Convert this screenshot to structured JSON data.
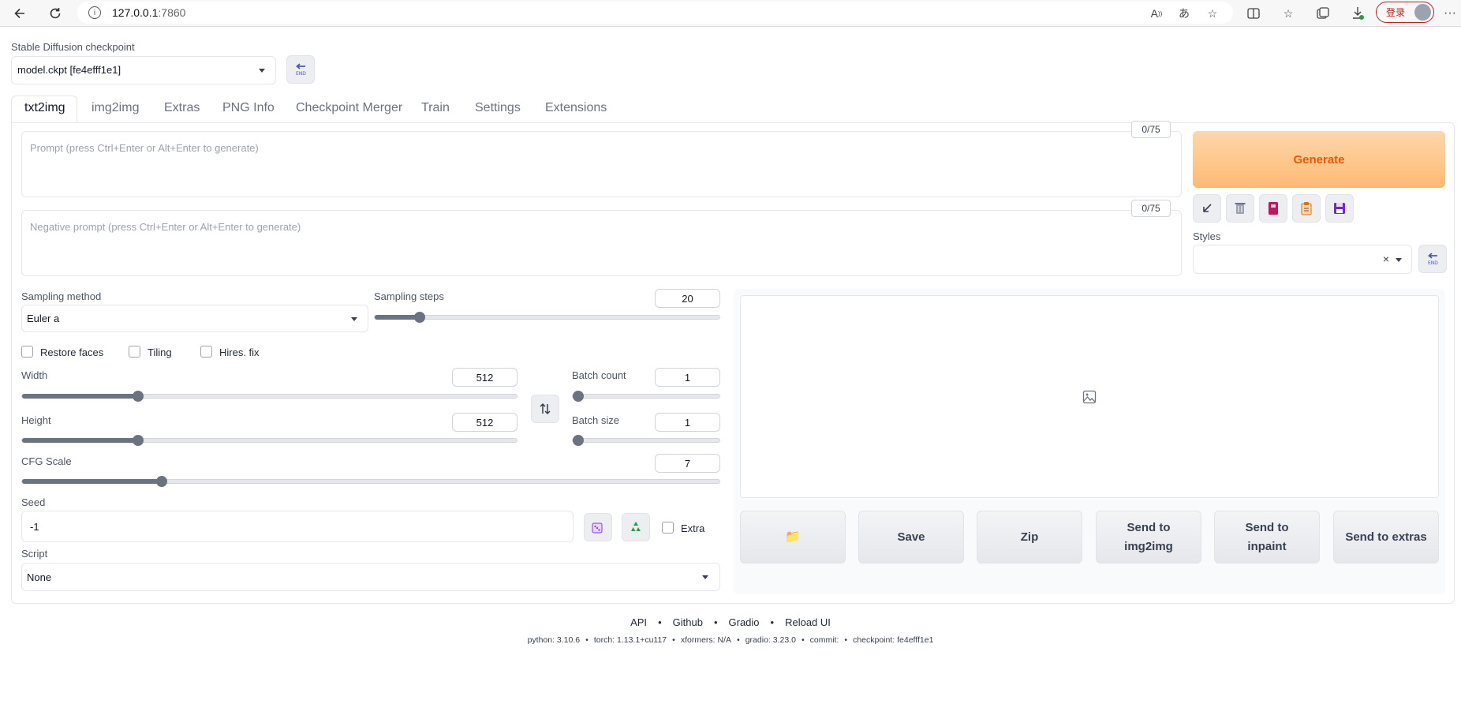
{
  "browser": {
    "url_host": "127.0.0.1",
    "url_port": ":7860",
    "login_label": "登录",
    "icons": [
      "back-icon",
      "refresh-icon",
      "info-icon",
      "read-aloud-icon",
      "translate-icon",
      "favorite-add-icon",
      "split-screen-icon",
      "favorites-icon",
      "collections-icon",
      "downloads-icon",
      "profile-icon",
      "more-icon"
    ]
  },
  "checkpoint": {
    "label": "Stable Diffusion checkpoint",
    "value": "model.ckpt [fe4efff1e1]"
  },
  "tabs": [
    {
      "label": "txt2img",
      "active": true
    },
    {
      "label": "img2img"
    },
    {
      "label": "Extras"
    },
    {
      "label": "PNG Info"
    },
    {
      "label": "Checkpoint Merger"
    },
    {
      "label": "Train"
    },
    {
      "label": "Settings"
    },
    {
      "label": "Extensions"
    }
  ],
  "prompt": {
    "placeholder": "Prompt (press Ctrl+Enter or Alt+Enter to generate)",
    "token_count": "0/75"
  },
  "negative_prompt": {
    "placeholder": "Negative prompt (press Ctrl+Enter or Alt+Enter to generate)",
    "token_count": "0/75"
  },
  "generate": {
    "label": "Generate",
    "color_top": "#fed7aa",
    "color_bottom": "#fdba74",
    "text_color": "#ea580c"
  },
  "tool_buttons": [
    "arrow-down-left-icon",
    "trash-icon",
    "book-icon",
    "clipboard-icon",
    "save-icon"
  ],
  "styles": {
    "label": "Styles",
    "clear_glyph": "×"
  },
  "sampling": {
    "method_label": "Sampling method",
    "method_value": "Euler a",
    "steps_label": "Sampling steps",
    "steps_value": "20",
    "steps_fraction": 0.13
  },
  "checkboxes": {
    "restore_faces": "Restore faces",
    "tiling": "Tiling",
    "hires_fix": "Hires. fix"
  },
  "width": {
    "label": "Width",
    "value": "512",
    "fraction": 0.235
  },
  "height": {
    "label": "Height",
    "value": "512",
    "fraction": 0.235
  },
  "batch_count": {
    "label": "Batch count",
    "value": "1",
    "fraction": 0.0
  },
  "batch_size": {
    "label": "Batch size",
    "value": "1",
    "fraction": 0.0
  },
  "cfg_scale": {
    "label": "CFG Scale",
    "value": "7",
    "fraction": 0.2
  },
  "seed": {
    "label": "Seed",
    "value": "-1",
    "extra_label": "Extra"
  },
  "script": {
    "label": "Script",
    "value": "None"
  },
  "output_buttons": {
    "folder": "📁",
    "save": "Save",
    "zip": "Zip",
    "send_img2img_1": "Send to",
    "send_img2img_2": "img2img",
    "send_inpaint_1": "Send to",
    "send_inpaint_2": "inpaint",
    "send_extras": "Send to extras"
  },
  "footer": {
    "links": [
      "API",
      "Github",
      "Gradio",
      "Reload UI"
    ],
    "separator": "•",
    "python": "python: 3.10.6",
    "torch": "torch: 1.13.1+cu117",
    "xformers": "xformers: N/A",
    "gradio": "gradio: 3.23.0",
    "commit": "commit:",
    "checkpoint": "checkpoint: fe4efff1e1"
  }
}
